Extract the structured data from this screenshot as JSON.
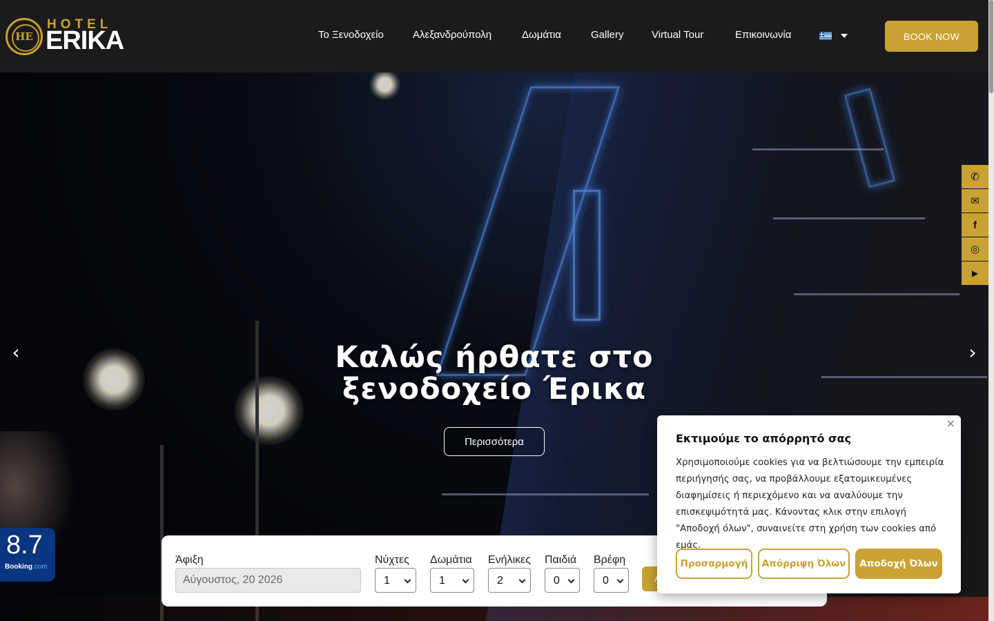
{
  "header": {
    "logo": {
      "top_text": "HOTEL",
      "main_text": "ERIKA",
      "emblem_letters": "HE"
    },
    "nav": [
      {
        "label": "Το Ξενοδοχείο"
      },
      {
        "label": "Αλεξανδρούπολη"
      },
      {
        "label": "Δωμάτια"
      },
      {
        "label": "Gallery"
      },
      {
        "label": "Virtual Tour"
      },
      {
        "label": "Επικοινωνία"
      }
    ],
    "language_icon": "greek-flag-icon",
    "book_label": "BOOK NOW"
  },
  "hero": {
    "title_line1": "Καλώς ήρθατε στο",
    "title_line2": "ξενοδοχείο Έρικα",
    "more_label": "Περισσότερα",
    "prev_icon": "‹",
    "next_icon": "›"
  },
  "social": [
    {
      "icon": "phone-icon",
      "glyph": "✆"
    },
    {
      "icon": "envelope-icon",
      "glyph": "✉"
    },
    {
      "icon": "facebook-icon",
      "glyph": "f"
    },
    {
      "icon": "instagram-icon",
      "glyph": "◎"
    },
    {
      "icon": "youtube-icon",
      "glyph": "▶"
    }
  ],
  "booking_badge": {
    "score": "8.7",
    "brand_main": "Booking",
    "brand_suffix": ".com"
  },
  "booking_form": {
    "arrival_label": "Άφιξη",
    "arrival_value": "Αύγουστος, 20 2026",
    "nights_label": "Νύχτες",
    "nights_value": "1",
    "rooms_label": "Δωμάτια",
    "rooms_value": "1",
    "adults_label": "Ενήλικες",
    "adults_value": "2",
    "children_label": "Παιδιά",
    "children_value": "0",
    "infants_label": "Βρέφη",
    "infants_value": "0",
    "submit_partial": "A"
  },
  "cookie": {
    "close": "×",
    "title": "Εκτιμούμε το απόρρητό σας",
    "text": "Χρησιμοποιούμε cookies για να βελτιώσουμε την εμπειρία περιήγησής σας, να προβάλλουμε εξατομικευμένες διαφημίσεις ή περιεχόμενο και να αναλύουμε την επισκεψιμότητά μας. Κάνοντας κλικ στην επιλογή \"Αποδοχή όλων\", συναινείτε στη χρήση των cookies από εμάς.",
    "customize_label": "Προσαρμογή",
    "reject_label": "Απόρριψη Όλων",
    "accept_label": "Αποδοχή Όλων"
  },
  "colors": {
    "accent": "#c9a233",
    "header_bg": "#1b1b1b",
    "booking_blue": "#0a3580"
  }
}
